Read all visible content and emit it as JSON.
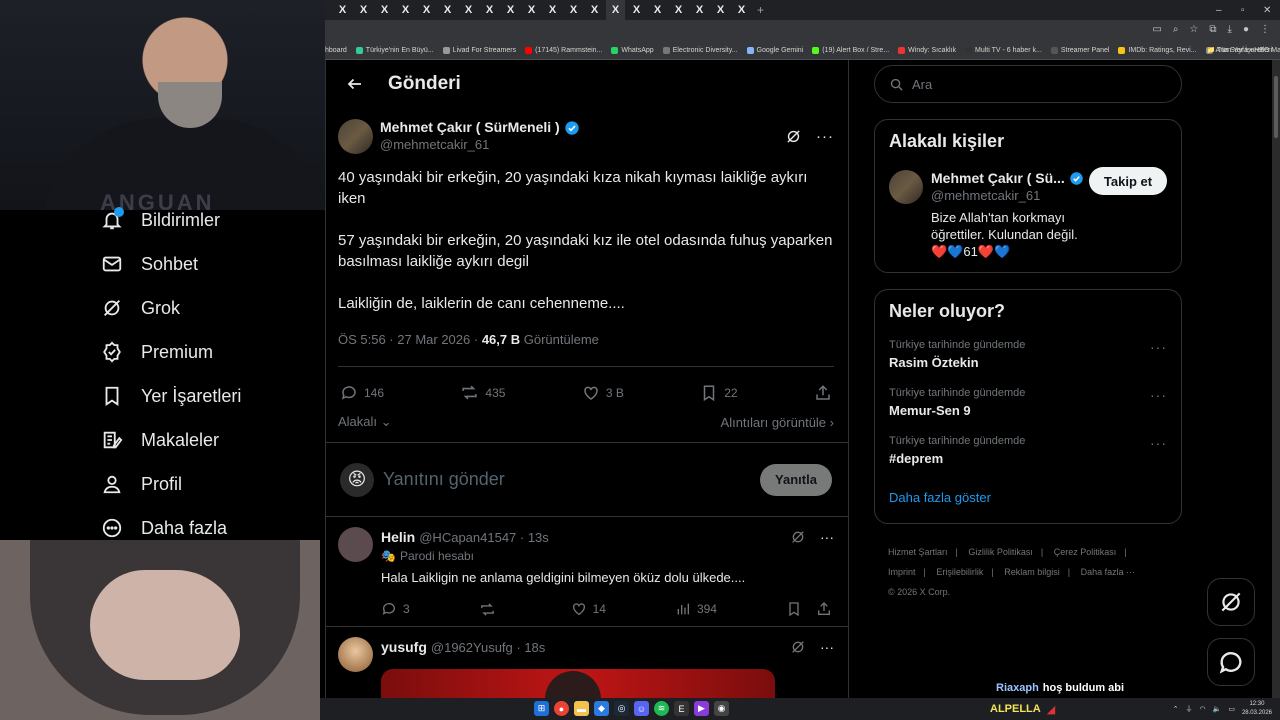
{
  "browser": {
    "tab_glyph": "X",
    "tab_count": 20,
    "new_tab": "+",
    "window_controls": [
      "–",
      "▫",
      "✕"
    ],
    "bookmarks": [
      {
        "label": "hboard",
        "color": "#1a73e8"
      },
      {
        "label": "Türkiye'nin En Büyü...",
        "color": "#3c9"
      },
      {
        "label": "Livad For Streamers",
        "color": "#999"
      },
      {
        "label": "(17145) Rammstein...",
        "color": "#f00"
      },
      {
        "label": "WhatsApp",
        "color": "#25d366"
      },
      {
        "label": "Electronic Diversity...",
        "color": "#777"
      },
      {
        "label": "Google Gemini",
        "color": "#8ab4f8"
      },
      {
        "label": "(19) Alert Box / Stre...",
        "color": "#53fc18"
      },
      {
        "label": "Windy: Sıcaklık",
        "color": "#e33"
      },
      {
        "label": "Multi TV - 6 haber k...",
        "color": "#333"
      },
      {
        "label": "Streamer Panel",
        "color": "#555"
      },
      {
        "label": "IMDb: Ratings, Revi...",
        "color": "#f5c518"
      },
      {
        "label": "Ana Sayfa • HBO Max",
        "color": "#888"
      }
    ],
    "bookmarks_more": "»",
    "all_bookmarks": "Tüm Yer İşaretleri"
  },
  "webcam": {
    "shirt_text": "ANGUAN"
  },
  "nav": {
    "items": [
      {
        "label": "Bildirimler",
        "icon": "bell-icon"
      },
      {
        "label": "Sohbet",
        "icon": "mail-icon"
      },
      {
        "label": "Grok",
        "icon": "grok-icon"
      },
      {
        "label": "Premium",
        "icon": "premium-icon"
      },
      {
        "label": "Yer İşaretleri",
        "icon": "bookmark-icon"
      },
      {
        "label": "Makaleler",
        "icon": "article-icon"
      },
      {
        "label": "Profil",
        "icon": "profile-icon"
      },
      {
        "label": "Daha fazla",
        "icon": "more-icon"
      }
    ]
  },
  "main": {
    "title": "Gönderi",
    "post": {
      "author_name": "Mehmet Çakır ( SürMeneli )",
      "author_handle": "@mehmetcakir_61",
      "text": "40 yaşındaki bir erkeğin, 20 yaşındaki kıza nikah kıyması laikliğe aykırı iken\n\n57 yaşındaki bir erkeğin, 20 yaşındaki kız ile otel odasında fuhuş yaparken basılması laikliğe aykırı degil\n\nLaikliğin de, laiklerin de canı cehenneme....",
      "timestamp": "ÖS 5:56 · 27 Mar 2026 ·",
      "views": "46,7 B",
      "views_label": "Görüntüleme",
      "replies": "146",
      "reposts": "435",
      "likes": "3 B",
      "bookmarks": "22",
      "related": "Alakalı",
      "quotes_link": "Alıntıları görüntüle"
    },
    "reply_box": {
      "placeholder": "Yanıtını gönder",
      "button": "Yanıtla"
    },
    "replies": [
      {
        "name": "Helin",
        "handle": "@HCapan41547 · 13s",
        "label": "Parodi hesabı",
        "text": "Hala Laikligin ne anlama geldigini bilmeyen öküz dolu ülkede....",
        "replies": "3",
        "reposts": "",
        "likes": "14",
        "views": "394",
        "avatar_color": "#5b4a4e"
      },
      {
        "name": "yusufg",
        "handle": "@1962Yusufg · 18s",
        "avatar_color": "#c9a27a"
      }
    ]
  },
  "right": {
    "search_placeholder": "Ara",
    "relevant": {
      "title": "Alakalı kişiler",
      "name": "Mehmet Çakır ( Sü...",
      "handle": "@mehmetcakir_61",
      "bio": "Bize Allah'tan korkmayı öğrettiler. Kulundan değil. ❤️💙61❤️💙",
      "follow": "Takip et"
    },
    "trends": {
      "title": "Neler oluyor?",
      "items": [
        {
          "category": "Türkiye tarihinde gündemde",
          "name": "Rasim Öztekin"
        },
        {
          "category": "Türkiye tarihinde gündemde",
          "name": "Memur-Sen 9"
        },
        {
          "category": "Türkiye tarihinde gündemde",
          "name": "#deprem"
        }
      ],
      "show_more": "Daha fazla göster"
    },
    "footer": {
      "links": [
        "Hizmet Şartları",
        "|",
        "Gizlilik Politikası",
        "|",
        "Çerez Politikası",
        "|",
        "Imprint",
        "|",
        "Erişilebilirlik",
        "|",
        "Reklam bilgisi",
        "|",
        "Daha fazla ···"
      ],
      "copyright": "© 2026 X Corp."
    }
  },
  "overlay": {
    "chat_user": "Riaxaph",
    "chat_msg": "hoş buldum abi",
    "streamer": "ALPELLA"
  },
  "taskbar": {
    "time": "12:30",
    "date": "28.03.2026"
  }
}
